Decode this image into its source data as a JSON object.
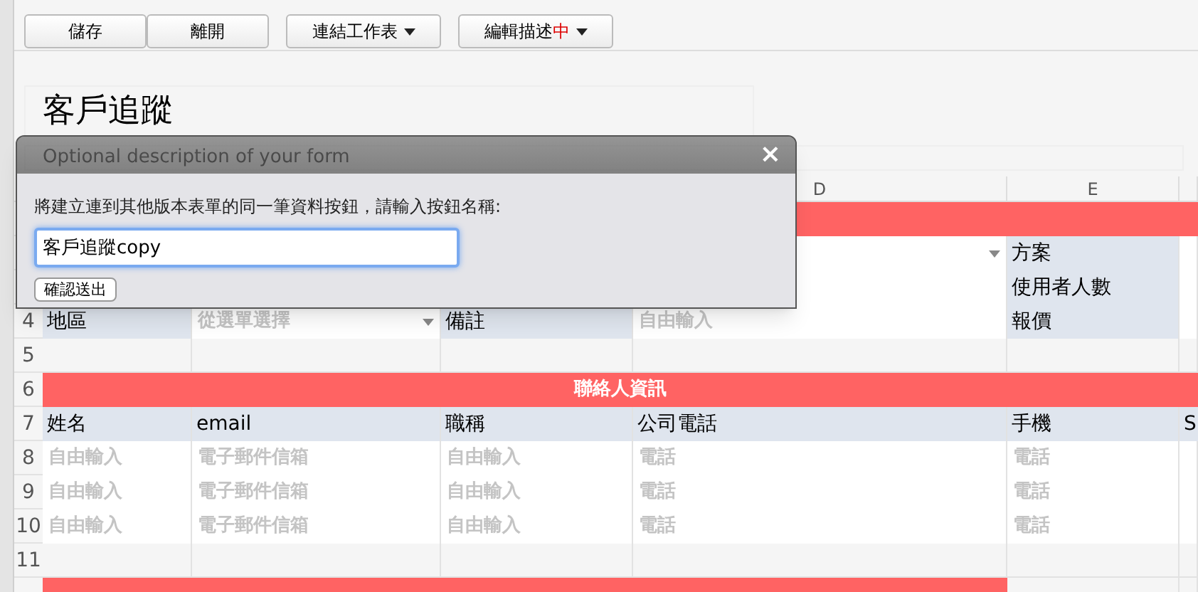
{
  "toolbar": {
    "buttons": [
      {
        "label": "儲存",
        "kind": "plain"
      },
      {
        "label": "離開",
        "kind": "plain"
      },
      {
        "label": "連結工作表",
        "kind": "menu"
      },
      {
        "label": "編輯描述",
        "suffix": "中",
        "kind": "menu"
      }
    ]
  },
  "form": {
    "title": "客戶追蹤",
    "description": "Optional description of your form"
  },
  "column_letters": [
    "D",
    "E"
  ],
  "rows": [
    {
      "cells": [
        {
          "kind": "section"
        }
      ]
    },
    {
      "cells": [
        {
          "kind": "blank"
        },
        {
          "kind": "blank"
        },
        {
          "kind": "blank"
        },
        {
          "kind": "select"
        },
        {
          "kind": "label",
          "text": "方案"
        },
        {
          "kind": "input"
        }
      ]
    },
    {
      "cells": [
        {
          "kind": "blank"
        },
        {
          "kind": "blank"
        },
        {
          "kind": "blank"
        },
        {
          "kind": "input"
        },
        {
          "kind": "label",
          "text": "使用者人數"
        },
        {
          "kind": "input"
        }
      ]
    },
    {
      "number": "4",
      "cells": [
        {
          "kind": "label",
          "text": "地區"
        },
        {
          "kind": "select",
          "text": "從選單選擇"
        },
        {
          "kind": "label",
          "text": "備註"
        },
        {
          "kind": "input",
          "text": "自由輸入"
        },
        {
          "kind": "label",
          "text": "報價"
        },
        {
          "kind": "input"
        }
      ]
    },
    {
      "number": "5",
      "cells": [
        {
          "kind": "empty"
        },
        {
          "kind": "empty"
        },
        {
          "kind": "empty"
        },
        {
          "kind": "empty"
        },
        {
          "kind": "empty"
        },
        {
          "kind": "empty"
        }
      ]
    },
    {
      "number": "6",
      "cells": [
        {
          "kind": "section",
          "text": "聯絡人資訊"
        }
      ]
    },
    {
      "number": "7",
      "cells": [
        {
          "kind": "label",
          "text": "姓名"
        },
        {
          "kind": "label",
          "text": "email"
        },
        {
          "kind": "label",
          "text": "職稱"
        },
        {
          "kind": "label",
          "text": "公司電話"
        },
        {
          "kind": "label",
          "text": "手機"
        },
        {
          "kind": "label",
          "text": "S"
        }
      ]
    },
    {
      "number": "8",
      "cells": [
        {
          "kind": "input",
          "text": "自由輸入"
        },
        {
          "kind": "input",
          "text": "電子郵件信箱"
        },
        {
          "kind": "input",
          "text": "自由輸入"
        },
        {
          "kind": "input",
          "text": "電話"
        },
        {
          "kind": "input",
          "text": "電話"
        },
        {
          "kind": "input"
        }
      ]
    },
    {
      "number": "9",
      "cells": [
        {
          "kind": "input",
          "text": "自由輸入"
        },
        {
          "kind": "input",
          "text": "電子郵件信箱"
        },
        {
          "kind": "input",
          "text": "自由輸入"
        },
        {
          "kind": "input",
          "text": "電話"
        },
        {
          "kind": "input",
          "text": "電話"
        },
        {
          "kind": "input"
        }
      ]
    },
    {
      "number": "10",
      "cells": [
        {
          "kind": "input",
          "text": "自由輸入"
        },
        {
          "kind": "input",
          "text": "電子郵件信箱"
        },
        {
          "kind": "input",
          "text": "自由輸入"
        },
        {
          "kind": "input",
          "text": "電話"
        },
        {
          "kind": "input",
          "text": "電話"
        },
        {
          "kind": "input"
        }
      ]
    },
    {
      "number": "11",
      "cells": [
        {
          "kind": "empty"
        },
        {
          "kind": "empty"
        },
        {
          "kind": "empty"
        },
        {
          "kind": "empty"
        },
        {
          "kind": "empty"
        },
        {
          "kind": "empty"
        }
      ]
    },
    {
      "cells": [
        {
          "kind": "section"
        },
        {
          "kind": "empty"
        },
        {
          "kind": "empty"
        }
      ]
    }
  ],
  "dialog": {
    "prompt": "將建立連到其他版本表單的同一筆資料按鈕，請輸入按鈕名稱:",
    "value": "客戶追蹤copy",
    "submit": "確認送出",
    "close": "×"
  }
}
